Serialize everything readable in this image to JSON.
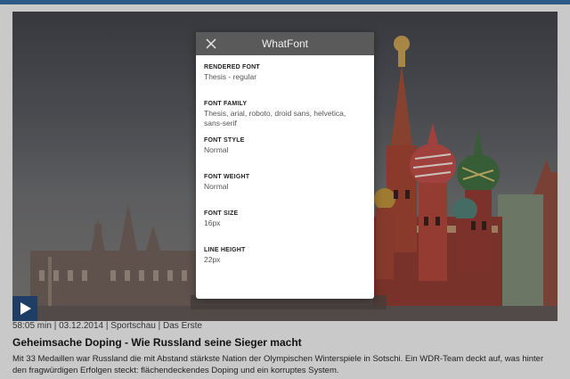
{
  "colors": {
    "brand": "#2e5a87",
    "panel_header": "#5a5a5a",
    "play_button": "#1f3e66"
  },
  "whatfont": {
    "title": "WhatFont",
    "fields": [
      {
        "label": "RENDERED FONT",
        "value": "Thesis - regular"
      },
      {
        "label": "FONT FAMILY",
        "value": "Thesis, arial, roboto, droid sans, helvetica, sans-serif"
      },
      {
        "label": "FONT STYLE",
        "value": "Normal"
      },
      {
        "label": "FONT WEIGHT",
        "value": "Normal"
      },
      {
        "label": "FONT SIZE",
        "value": "16px"
      },
      {
        "label": "LINE HEIGHT",
        "value": "22px"
      }
    ]
  },
  "video": {
    "meta": "58:05 min | 03.12.2014 | Sportschau | Das Erste",
    "title": "Geheimsache Doping - Wie Russland seine Sieger macht",
    "summary": "Mit 33 Medaillen war Russland die mit Abstand stärkste Nation der Olympischen Winterspiele in Sotschi. Ein WDR-Team deckt auf, was hinter den fragwürdigen Erfolgen steckt: flächendeckendes Doping und ein korruptes System."
  }
}
